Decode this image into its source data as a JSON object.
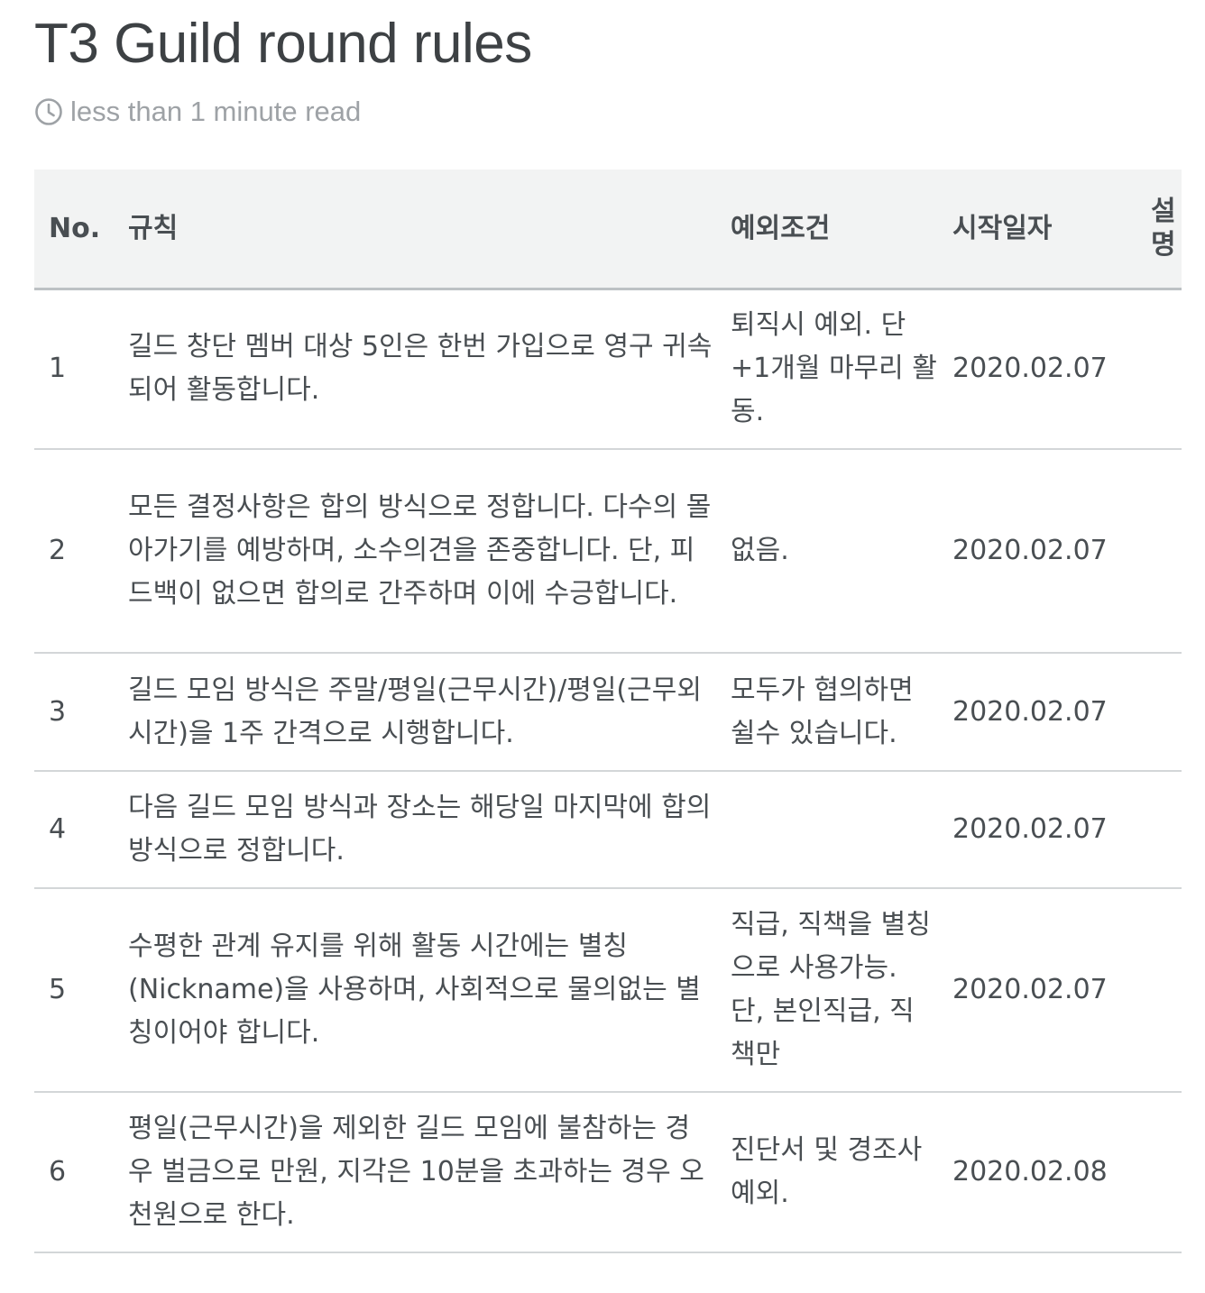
{
  "page": {
    "title": "T3 Guild round rules",
    "read_time": "less than 1 minute read",
    "read_time_icon": "clock-icon"
  },
  "table": {
    "headers": {
      "no": "No.",
      "rule": "규칙",
      "exception": "예외조건",
      "start_date": "시작일자",
      "description_line1": "설",
      "description_line2": "명"
    },
    "rows": [
      {
        "no": "1",
        "rule": "길드 창단 멤버 대상 5인은 한번 가입으로 영구 귀속되어 활동합니다.",
        "exception": "퇴직시 예외. 단 +1개월 마무리 활동.",
        "start_date": "2020.02.07",
        "description": ""
      },
      {
        "no": "2",
        "rule": "모든 결정사항은 합의 방식으로 정합니다. 다수의 몰아가기를 예방하며, 소수의견을 존중합니다. 단, 피드백이 없으면 합의로 간주하며 이에 수긍합니다.",
        "exception": "없음.",
        "start_date": "2020.02.07",
        "description": ""
      },
      {
        "no": "3",
        "rule": "길드 모임 방식은 주말/평일(근무시간)/평일(근무외시간)을 1주 간격으로 시행합니다.",
        "exception": "모두가 협의하면 쉴수 있습니다.",
        "start_date": "2020.02.07",
        "description": ""
      },
      {
        "no": "4",
        "rule": "다음 길드 모임 방식과 장소는 해당일 마지막에 합의 방식으로 정합니다.",
        "exception": "",
        "start_date": "2020.02.07",
        "description": ""
      },
      {
        "no": "5",
        "rule": "수평한 관계 유지를 위해 활동 시간에는 별칭(Nickname)을 사용하며, 사회적으로 물의없는 별칭이어야 합니다.",
        "exception": "직급, 직책을 별칭으로 사용가능. 단, 본인직급, 직책만",
        "start_date": "2020.02.07",
        "description": ""
      },
      {
        "no": "6",
        "rule": "평일(근무시간)을 제외한 길드 모임에 불참하는 경우 벌금으로 만원, 지각은 10분을 초과하는 경우 오천원으로 한다.",
        "exception": "진단서 및 경조사 예외.",
        "start_date": "2020.02.08",
        "description": ""
      }
    ]
  }
}
